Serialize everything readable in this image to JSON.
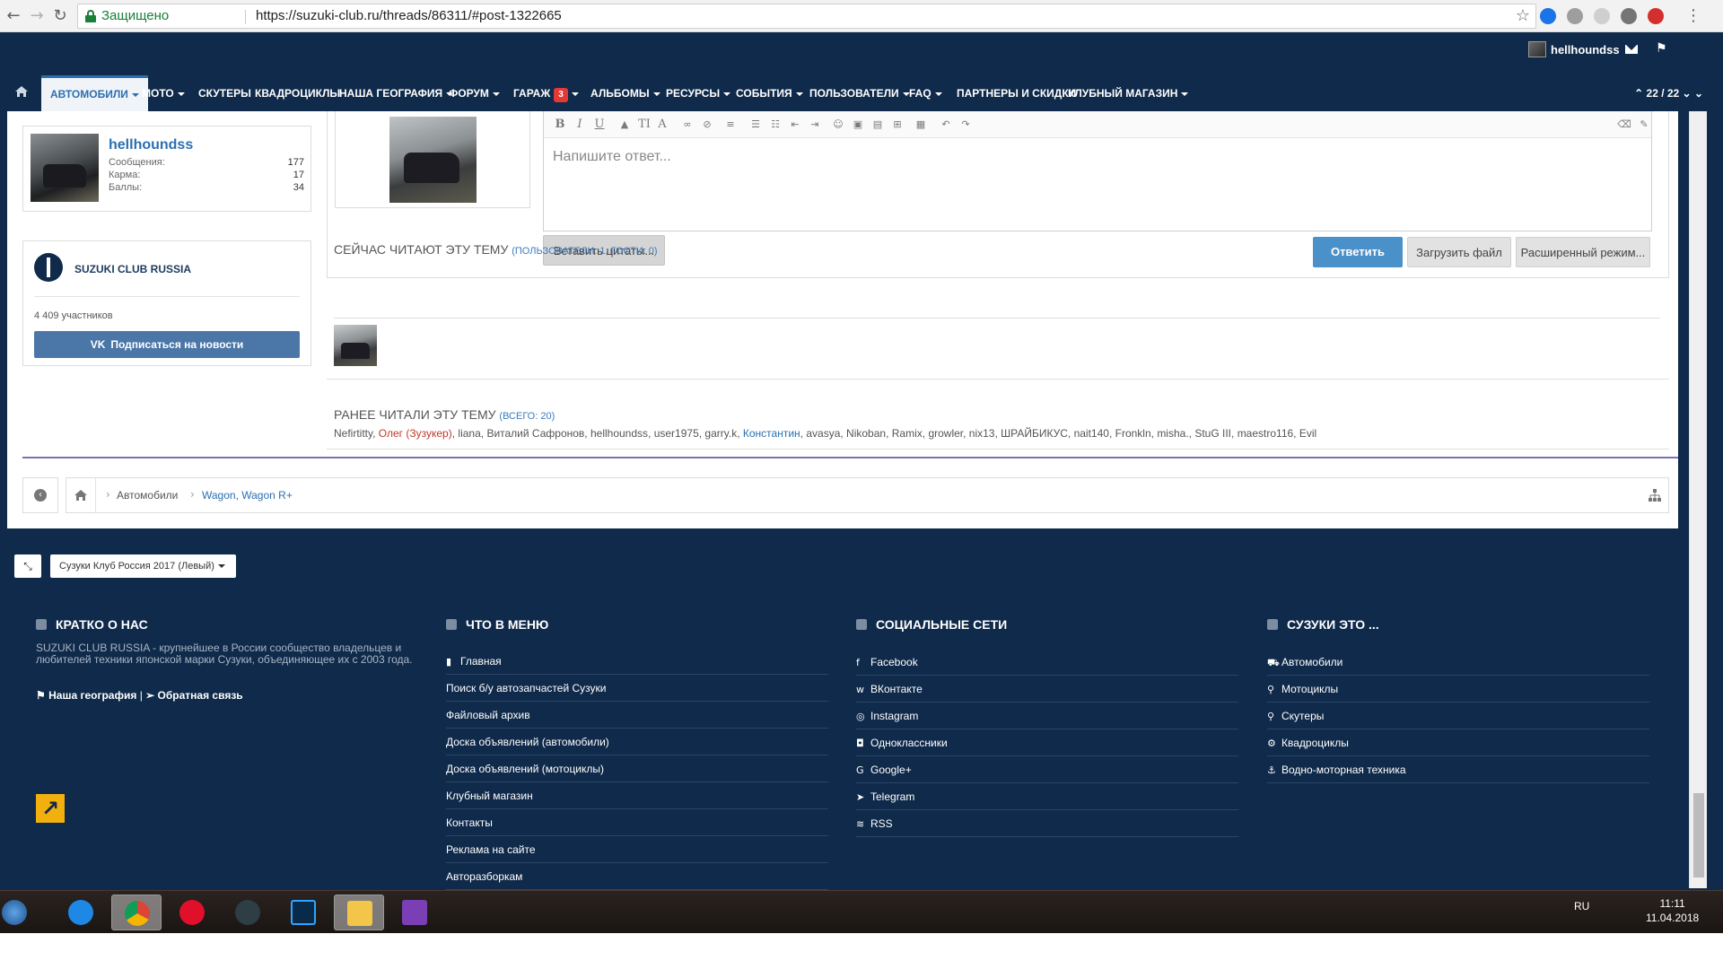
{
  "browser": {
    "secure_label": "Защищено",
    "url": "https://suzuki-club.ru/threads/86311/#post-1322665"
  },
  "topbar": {
    "username": "hellhoundss"
  },
  "nav": {
    "items": [
      {
        "label": "АВТОМОБИЛИ",
        "caret": true
      },
      {
        "label": "МОТО",
        "caret": true
      },
      {
        "label": "СКУТЕРЫ",
        "caret": false
      },
      {
        "label": "КВАДРОЦИКЛЫ",
        "caret": false
      },
      {
        "label": "НАША ГЕОГРАФИЯ",
        "caret": true
      },
      {
        "label": "ФОРУМ",
        "caret": true
      },
      {
        "label": "ГАРАЖ",
        "caret": true,
        "badge": "3"
      },
      {
        "label": "АЛЬБОМЫ",
        "caret": true
      },
      {
        "label": "РЕСУРСЫ",
        "caret": true
      },
      {
        "label": "СОБЫТИЯ",
        "caret": true
      },
      {
        "label": "ПОЛЬЗОВАТЕЛИ",
        "caret": true
      },
      {
        "label": "FAQ",
        "caret": true
      },
      {
        "label": "ПАРТНЕРЫ И СКИДКИ",
        "caret": false
      },
      {
        "label": "КЛУБНЫЙ МАГАЗИН",
        "caret": true
      }
    ],
    "pager": "22 / 22"
  },
  "user_card": {
    "name": "hellhoundss",
    "stats": [
      {
        "label": "Сообщения:",
        "value": "177"
      },
      {
        "label": "Карма:",
        "value": "17"
      },
      {
        "label": "Баллы:",
        "value": "34"
      }
    ]
  },
  "club": {
    "name": "SUZUKI CLUB RUSSIA",
    "members": "4 409 участников",
    "subscribe": "Подписаться на новости"
  },
  "editor": {
    "placeholder": "Напишите ответ...",
    "quote_button": "Вставить цитаты...",
    "reply_button": "Ответить",
    "upload_button": "Загрузить файл",
    "advanced_button": "Расширенный режим..."
  },
  "reading_now": {
    "title": "СЕЙЧАС ЧИТАЮТ ЭТУ ТЕМУ",
    "sub": "(ПОЛЬЗОВАТЕЛИ: 1, ГОСТИ: 0)"
  },
  "previously_read": {
    "title": "РАНЕЕ ЧИТАЛИ ЭТУ ТЕМУ",
    "sub": "(ВСЕГО: 20)",
    "names": [
      {
        "name": "Nefirtitty",
        "style": "normal"
      },
      {
        "name": "Олег (Зузукер)",
        "style": "red"
      },
      {
        "name": "liana",
        "style": "normal"
      },
      {
        "name": "Виталий Сафронов",
        "style": "normal"
      },
      {
        "name": "hellhoundss",
        "style": "normal"
      },
      {
        "name": "user1975",
        "style": "normal"
      },
      {
        "name": "garry.k",
        "style": "normal"
      },
      {
        "name": "Константин",
        "style": "blue"
      },
      {
        "name": "avasya",
        "style": "normal"
      },
      {
        "name": "Nikoban",
        "style": "normal"
      },
      {
        "name": "Ramix",
        "style": "normal"
      },
      {
        "name": "growler",
        "style": "normal"
      },
      {
        "name": "nix13",
        "style": "normal"
      },
      {
        "name": "ШРАЙБИКУС",
        "style": "normal"
      },
      {
        "name": "nait140",
        "style": "normal"
      },
      {
        "name": "Fronkln",
        "style": "normal"
      },
      {
        "name": "misha.",
        "style": "normal"
      },
      {
        "name": "StuG III",
        "style": "normal"
      },
      {
        "name": "maestro116",
        "style": "normal"
      },
      {
        "name": "Evil",
        "style": "normal"
      }
    ]
  },
  "breadcrumb": {
    "items": [
      "Автомобили",
      "Wagon, Wagon R+"
    ]
  },
  "footer": {
    "style_select": "Сузуки Клуб Россия 2017 (Левый)",
    "about": {
      "title": "КРАТКО О НАС",
      "text": "SUZUKI CLUB RUSSIA - крупнейшее в России сообщество владельцев и любителей техники японской марки Сузуки, объединяющее их с 2003 года.",
      "link_geo": "Наша география",
      "link_feedback": "Обратная связь"
    },
    "menu": {
      "title": "ЧТО В МЕНЮ",
      "items": [
        "Главная",
        "Поиск б/у автозапчастей Сузуки",
        "Файловый архив",
        "Доска объявлений (автомобили)",
        "Доска объявлений (мотоциклы)",
        "Клубный магазин",
        "Контакты",
        "Реклама на сайте",
        "Авторазборкам"
      ]
    },
    "social": {
      "title": "СОЦИАЛЬНЫЕ СЕТИ",
      "items": [
        "Facebook",
        "ВКонтакте",
        "Instagram",
        "Одноклассники",
        "Google+",
        "Telegram",
        "RSS"
      ]
    },
    "suzuki": {
      "title": "СУЗУКИ ЭТО ...",
      "items": [
        "Автомобили",
        "Мотоциклы",
        "Скутеры",
        "Квадроциклы",
        "Водно-моторная техника"
      ]
    }
  },
  "taskbar": {
    "lang": "RU",
    "time": "11:11",
    "date": "11.04.2018"
  },
  "colors": {
    "navy": "#0f2a4a",
    "link": "#2b6fb0",
    "reply": "#4a90c9",
    "vk": "#4a76a8",
    "accent_purple": "#7e6fae"
  }
}
